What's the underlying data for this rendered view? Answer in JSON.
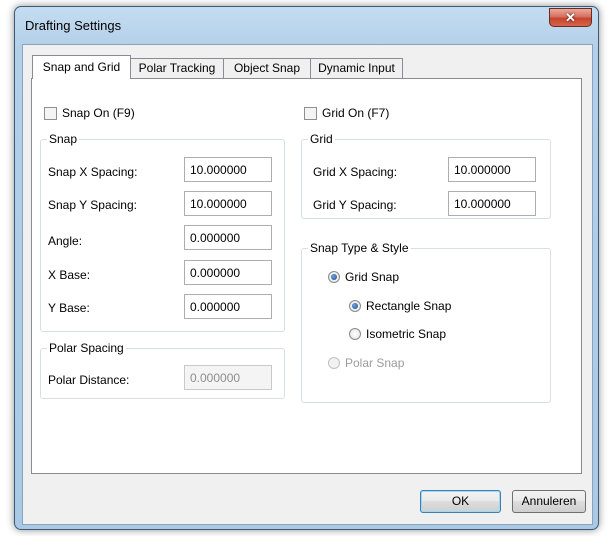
{
  "window": {
    "title": "Drafting Settings"
  },
  "tabs": [
    "Snap and Grid",
    "Polar Tracking",
    "Object Snap",
    "Dynamic Input"
  ],
  "snap_on_label": "Snap On (F9)",
  "grid_on_label": "Grid On (F7)",
  "snap_group": {
    "title": "Snap",
    "x_spacing": {
      "label": "Snap X Spacing:",
      "value": "10.000000"
    },
    "y_spacing": {
      "label": "Snap Y Spacing:",
      "value": "10.000000"
    },
    "angle": {
      "label": "Angle:",
      "value": "0.000000"
    },
    "x_base": {
      "label": "X Base:",
      "value": "0.000000"
    },
    "y_base": {
      "label": "Y Base:",
      "value": "0.000000"
    }
  },
  "polar_group": {
    "title": "Polar Spacing",
    "distance": {
      "label": "Polar Distance:",
      "value": "0.000000"
    }
  },
  "grid_group": {
    "title": "Grid",
    "x_spacing": {
      "label": "Grid X Spacing:",
      "value": "10.000000"
    },
    "y_spacing": {
      "label": "Grid Y Spacing:",
      "value": "10.000000"
    }
  },
  "snap_type_group": {
    "title": "Snap Type & Style",
    "grid_snap": "Grid Snap",
    "rectangle_snap": "Rectangle Snap",
    "isometric_snap": "Isometric Snap",
    "polar_snap": "Polar Snap"
  },
  "buttons": {
    "ok": "OK",
    "cancel": "Annuleren"
  }
}
